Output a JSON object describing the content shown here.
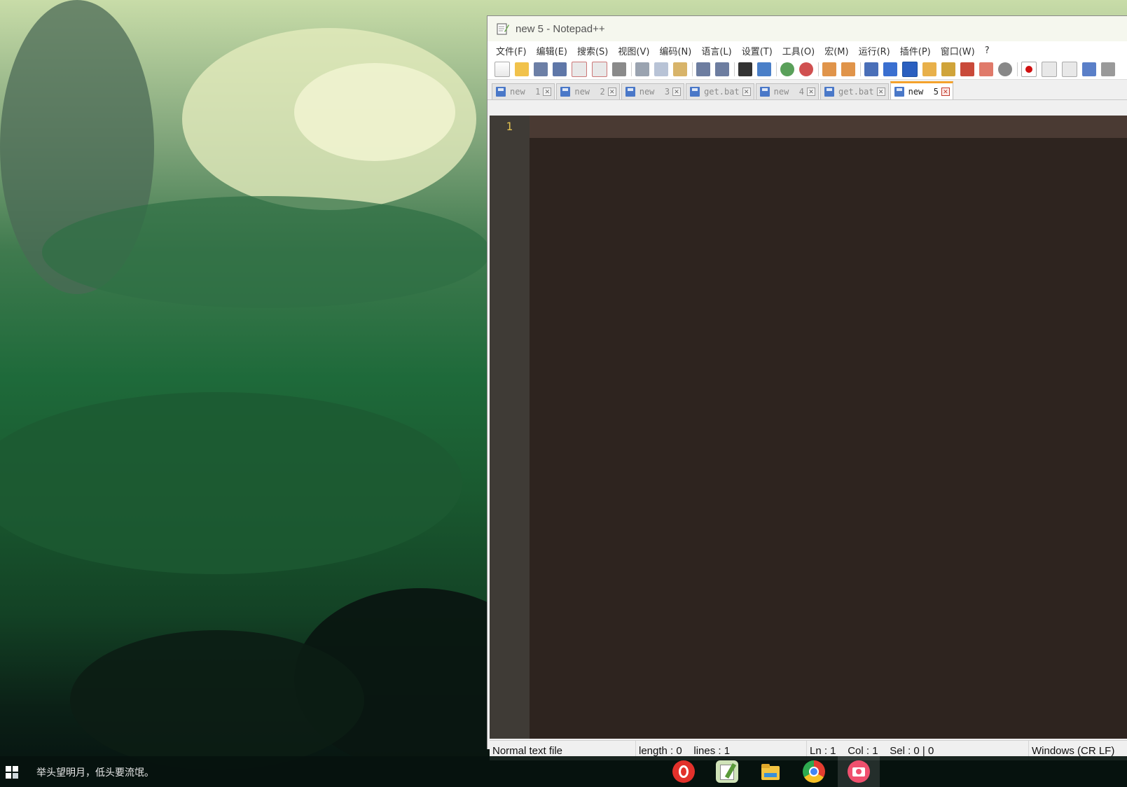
{
  "window": {
    "title": "new 5 - Notepad++"
  },
  "menu": [
    "文件(F)",
    "编辑(E)",
    "搜索(S)",
    "视图(V)",
    "编码(N)",
    "语言(L)",
    "设置(T)",
    "工具(O)",
    "宏(M)",
    "运行(R)",
    "插件(P)",
    "窗口(W)",
    "?"
  ],
  "toolbar_icons": [
    "new-file-icon",
    "open-file-icon",
    "save-icon",
    "save-all-icon",
    "close-icon",
    "close-all-icon",
    "print-icon",
    "cut-icon",
    "copy-icon",
    "paste-icon",
    "undo-icon",
    "redo-icon",
    "find-icon",
    "replace-icon",
    "zoom-in-icon",
    "zoom-out-icon",
    "sync-vertical-icon",
    "sync-horizontal-icon",
    "word-wrap-icon",
    "show-all-chars-icon",
    "indent-guide-icon",
    "user-defined-lang-icon",
    "doc-map-icon",
    "function-list-icon",
    "folder-workspace-icon",
    "monitoring-icon",
    "record-macro-icon",
    "stop-macro-icon",
    "play-macro-icon",
    "run-macro-multiple-icon",
    "save-macro-icon"
  ],
  "tabs": [
    {
      "label": "new  1",
      "active": false
    },
    {
      "label": "new  2",
      "active": false
    },
    {
      "label": "new  3",
      "active": false
    },
    {
      "label": "get.bat",
      "active": false
    },
    {
      "label": "new  4",
      "active": false
    },
    {
      "label": "get.bat",
      "active": false
    },
    {
      "label": "new  5",
      "active": true
    }
  ],
  "editor": {
    "line_number": "1",
    "content": ""
  },
  "status": {
    "file_type": "Normal text file",
    "length_lines": "length : 0    lines : 1",
    "position": "Ln : 1    Col : 1    Sel : 0 | 0",
    "eol": "Windows (CR LF)"
  },
  "taskbar": {
    "motto": "举头望明月，低头要流氓。",
    "apps": [
      "netease-music-icon",
      "notepad-plus-plus-icon",
      "file-explorer-icon",
      "chrome-icon",
      "screenshot-camera-icon"
    ]
  },
  "colors": {
    "editor_bg": "#2e241f",
    "gutter_bg": "#3f3b36",
    "line_number": "#e0c050",
    "active_tab_accent": "#f4a22c"
  }
}
